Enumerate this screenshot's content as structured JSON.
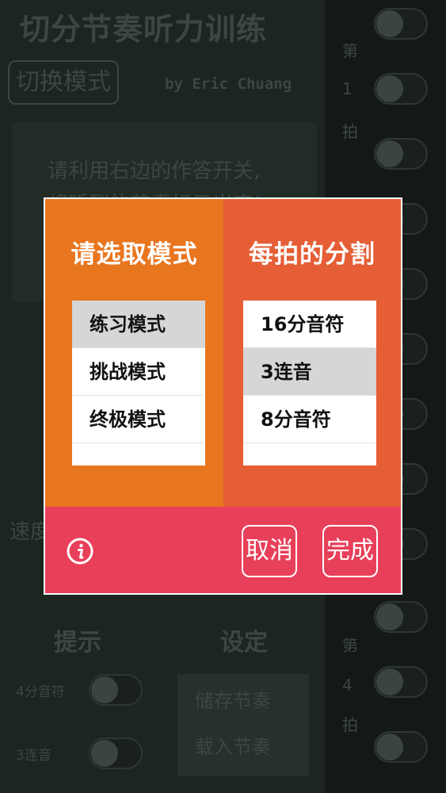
{
  "app": {
    "title": "切分节奏听力训练",
    "switch_mode": "切换模式",
    "author": "by Eric Chuang",
    "instructions": [
      "请利用右边的作答开关,",
      "将听到的节奏标示出来!"
    ],
    "speed_label": "速度",
    "hint_label": "提示",
    "settings_label": "设定",
    "option_16th": "4分音符",
    "option_triplet": "3连音",
    "save_rhythm": "储存节奏",
    "load_rhythm": "载入节奏",
    "side_chars": [
      "第",
      "1",
      "拍",
      "第",
      "4",
      "拍"
    ]
  },
  "modal": {
    "left_title": "请选取模式",
    "right_title": "每拍的分割",
    "modes": [
      "练习模式",
      "挑战模式",
      "终极模式"
    ],
    "selected_mode": "练习模式",
    "divisions": [
      "16分音符",
      "3连音",
      "8分音符"
    ],
    "selected_division": "3连音",
    "cancel": "取消",
    "done": "完成",
    "info_icon": "info-icon"
  },
  "colors": {
    "left_panel": "#e8761f",
    "right_panel": "#e55e36",
    "footer": "#e8405a",
    "selected_row": "#d6d6d6"
  }
}
